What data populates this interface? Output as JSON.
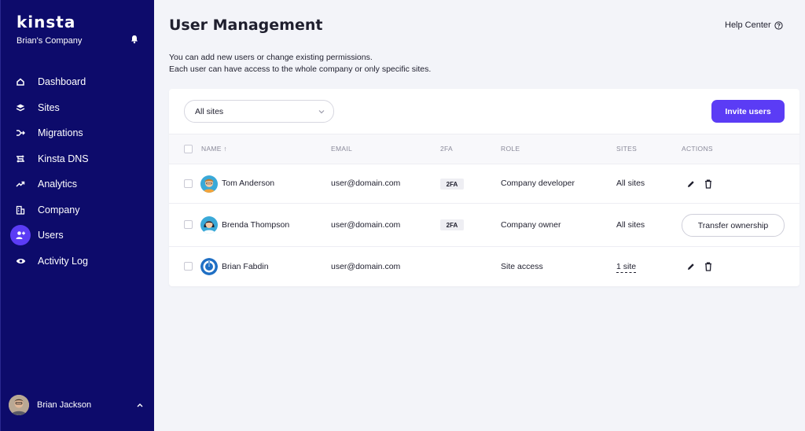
{
  "sidebar": {
    "logo": "kinsta",
    "company": "Brian's Company",
    "items": [
      {
        "label": "Dashboard",
        "icon": "home-icon"
      },
      {
        "label": "Sites",
        "icon": "layers-icon"
      },
      {
        "label": "Migrations",
        "icon": "migrate-icon"
      },
      {
        "label": "Kinsta DNS",
        "icon": "dns-icon"
      },
      {
        "label": "Analytics",
        "icon": "trend-icon"
      },
      {
        "label": "Company",
        "icon": "building-icon"
      },
      {
        "label": "Users",
        "icon": "add-user-icon",
        "active": true
      },
      {
        "label": "Activity Log",
        "icon": "eye-icon"
      }
    ],
    "user_name": "Brian Jackson"
  },
  "header": {
    "title": "User Management",
    "help": "Help Center",
    "desc_line1": "You can add new users or change existing permissions.",
    "desc_line2": "Each user can have access to the whole company or only specific sites."
  },
  "toolbar": {
    "filter_value": "All sites",
    "invite_label": "Invite users"
  },
  "table": {
    "columns": [
      "NAME ↑",
      "EMAIL",
      "2FA",
      "ROLE",
      "SITES",
      "ACTIONS"
    ],
    "rows": [
      {
        "name": "Tom Anderson",
        "email": "user@domain.com",
        "twofa": "2FA",
        "role": "Company developer",
        "sites": "All sites"
      },
      {
        "name": "Brenda Thompson",
        "email": "user@domain.com",
        "twofa": "2FA",
        "role": "Company owner",
        "sites": "All sites",
        "action": "Transfer ownership"
      },
      {
        "name": "Brian Fabdin",
        "email": "user@domain.com",
        "twofa": "",
        "role": "Site access",
        "sites": "1 site"
      }
    ]
  },
  "colors": {
    "sidebar_bg": "#0d0b6b",
    "accent": "#5b3cf5",
    "page_bg": "#f3f4f9"
  }
}
